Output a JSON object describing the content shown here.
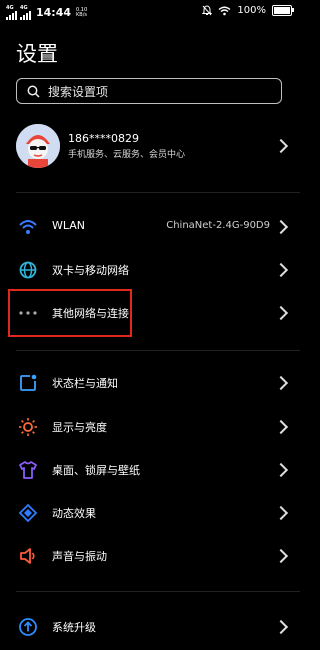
{
  "status_bar": {
    "network_left": "4G",
    "network_left2": "4G",
    "time": "14:44",
    "speed_value": "0.10",
    "speed_unit": "KB/s",
    "battery": "100%"
  },
  "page": {
    "title": "设置"
  },
  "search": {
    "placeholder": "搜索设置项"
  },
  "account": {
    "phone": "186****0829",
    "subtitle": "手机服务、云服务、会员中心"
  },
  "items": [
    {
      "label": "WLAN",
      "value": "ChinaNet-2.4G-90D9",
      "icon": "wifi-icon"
    },
    {
      "label": "双卡与移动网络",
      "icon": "globe-icon"
    },
    {
      "label": "其他网络与连接",
      "icon": "more-dots-icon"
    },
    {
      "label": "状态栏与通知",
      "icon": "notification-icon"
    },
    {
      "label": "显示与亮度",
      "icon": "sun-icon"
    },
    {
      "label": "桌面、锁屏与壁纸",
      "icon": "tshirt-icon"
    },
    {
      "label": "动态效果",
      "icon": "diamond-icon"
    },
    {
      "label": "声音与振动",
      "icon": "speaker-icon"
    },
    {
      "label": "系统升级",
      "icon": "upgrade-icon"
    }
  ],
  "colors": {
    "background": "#000000",
    "highlight_box": "#e0291c",
    "wifi": "#3a7bff",
    "globe": "#2fb3d8",
    "notification": "#3aa3ff",
    "sun": "#ff6a3d",
    "tshirt": "#8a5cff",
    "diamond": "#2f7dff",
    "speaker": "#ff5a3a",
    "upgrade": "#2f8cff"
  }
}
